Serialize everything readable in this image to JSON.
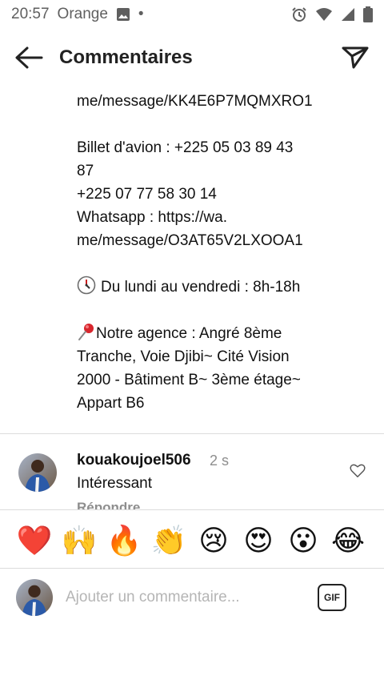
{
  "status_bar": {
    "time": "20:57",
    "carrier": "Orange",
    "dot": "•",
    "icons": [
      "image-icon",
      "alarm-icon",
      "wifi-icon",
      "signal-icon",
      "battery-icon"
    ]
  },
  "header": {
    "title": "Commentaires",
    "back_icon": "arrow-left-icon",
    "share_icon": "send-icon"
  },
  "caption": {
    "link1": "me/message/KK4E6P7MQMXRO1",
    "billet_line1": "Billet d'avion : +225 05 03 89 43",
    "billet_line2": "87",
    "phone2": "+225 07 77 58 30 14",
    "whatsapp_line1": "Whatsapp : https://wa.",
    "whatsapp_line2": "me/message/O3AT65V2LXOOA1",
    "hours": "Du lundi au vendredi : 8h-18h",
    "agency_line1": "Notre agence : Angré 8ème",
    "agency_line2": "Tranche, Voie Djibi~ Cité Vision",
    "agency_line3": "2000 - Bâtiment B~ 3ème étage~",
    "agency_line4": "Appart B6"
  },
  "comments": [
    {
      "username": "kouakoujoel506",
      "time": "2 s",
      "text": "Intéressant",
      "reply_label": "Répondre"
    }
  ],
  "emoji_bar": [
    "❤️",
    "🙌",
    "🔥",
    "👏",
    "😢",
    "😍",
    "😮",
    "😂"
  ],
  "composer": {
    "placeholder": "Ajouter un commentaire...",
    "gif_label": "GIF"
  },
  "colors": {
    "text": "#111111",
    "muted": "#8e8e8e",
    "placeholder": "#b5b5b5",
    "divider": "#dcdcdc"
  }
}
